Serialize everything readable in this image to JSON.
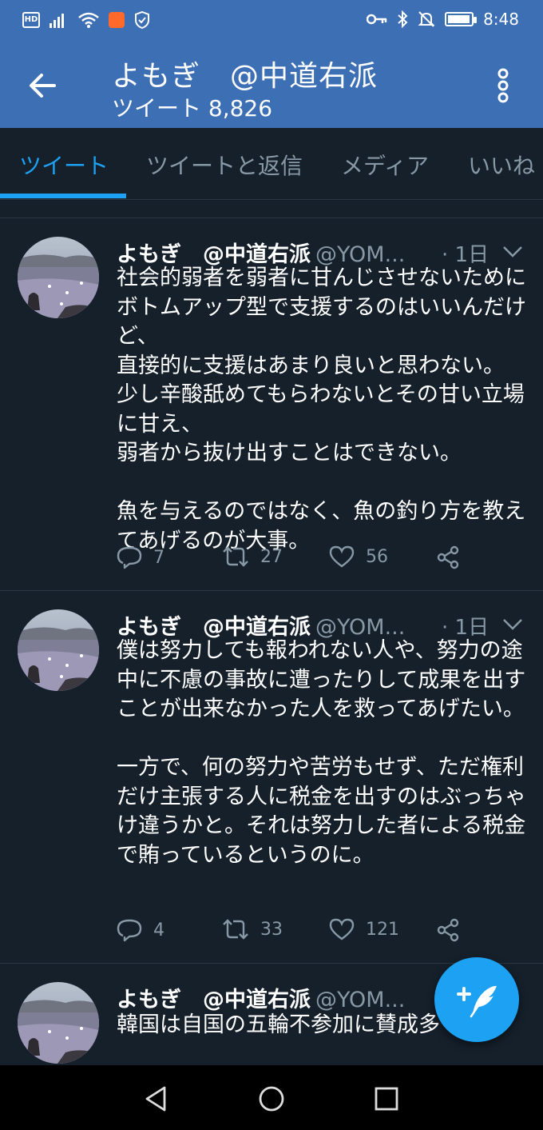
{
  "status_bar": {
    "hd_label": "HD",
    "time": "8:48",
    "battery_level": 0.95,
    "icons": [
      "hd-icon",
      "signal-icon",
      "wifi-icon",
      "app-notification-icon",
      "shield-icon",
      "key-icon",
      "bluetooth-icon",
      "mute-icon",
      "battery-icon"
    ]
  },
  "header": {
    "title": "よもぎ　@中道右派",
    "subtitle": "ツイート 8,826"
  },
  "tabs": [
    {
      "label": "ツイート",
      "active": true
    },
    {
      "label": "ツイートと返信",
      "active": false
    },
    {
      "label": "メディア",
      "active": false
    },
    {
      "label": "いいね",
      "active": false
    }
  ],
  "tweets": [
    {
      "name": "よもぎ　@中道右派",
      "handle": "@YOM...",
      "time": "· 1日",
      "body": "社会的弱者を弱者に甘んじさせないために\nボトムアップ型で支援するのはいいんだけど、\n直接的に支援はあまり良いと思わない。\n少し辛酸舐めてもらわないとその甘い立場に甘え、\n弱者から抜け出すことはできない。\n\n魚を与えるのではなく、魚の釣り方を教えてあげるのが大事。",
      "replies": "7",
      "retweets": "27",
      "likes": "56"
    },
    {
      "name": "よもぎ　@中道右派",
      "handle": "@YOM...",
      "time": "· 1日",
      "body": "僕は努力しても報われない人や、努力の途中に不慮の事故に遭ったりして成果を出すことが出来なかった人を救ってあげたい。\n\n一方で、何の努力や苦労もせず、ただ権利だけ主張する人に税金を出すのはぶっちゃけ違うかと。それは努力した者による税金で賄っているというのに。",
      "replies": "4",
      "retweets": "33",
      "likes": "121"
    },
    {
      "name": "よもぎ　@中道右派",
      "handle": "@YOM...",
      "body": "韓国は自国の五輪不参加に賛成多"
    }
  ],
  "accent_color": "#1da1f2",
  "header_color": "#3d6fb5",
  "background_color": "#15202b"
}
